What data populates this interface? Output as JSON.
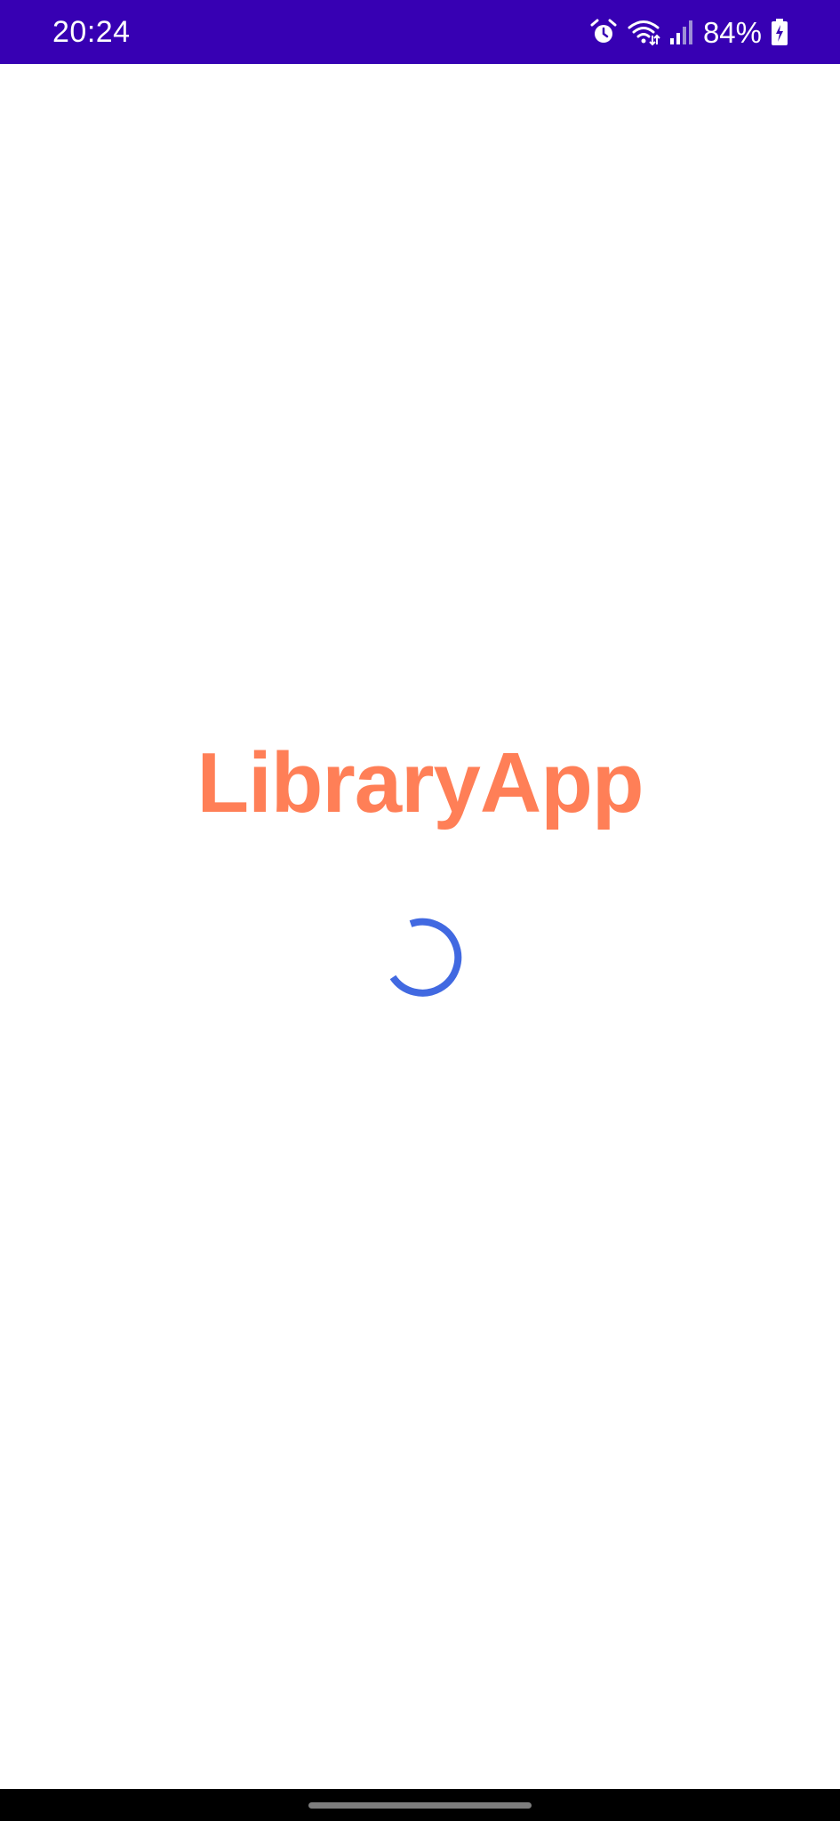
{
  "status_bar": {
    "time": "20:24",
    "battery_percent": "84%",
    "icons": [
      "alarm-icon",
      "wifi-icon",
      "signal-icon",
      "battery-charging-icon"
    ],
    "background_color": "#3700b3"
  },
  "splash": {
    "app_name": "LibraryApp",
    "title_color": "#ff7f57",
    "spinner_color": "#4169e1"
  },
  "nav_bar": {
    "icons": [
      "home-gesture-handle"
    ]
  }
}
